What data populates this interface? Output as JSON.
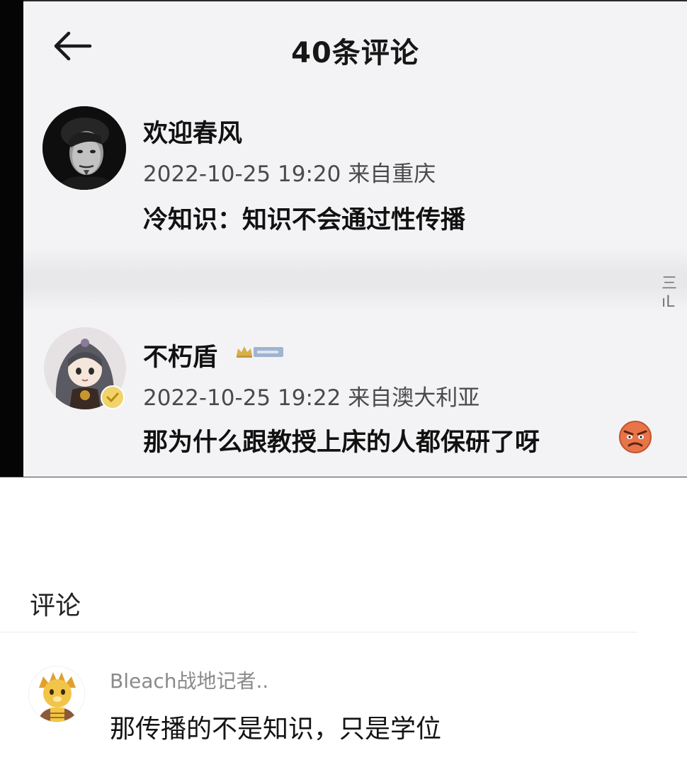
{
  "screenshot": {
    "title": "40条评论",
    "side_glyph": "三ıL",
    "comments": [
      {
        "username": "欢迎春风",
        "meta": "2022-10-25 19:20 来自重庆",
        "text": "冷知识：知识不会通过性传播",
        "avatar_icon": "man-portrait-avatar"
      },
      {
        "username": "不朽盾",
        "meta": "2022-10-25 19:22 来自澳大利亚",
        "text": "那为什么跟教授上床的人都保研了呀",
        "avatar_icon": "anime-character-avatar",
        "badge_icon": "member-badge-icon",
        "emoji": "angry-face-emoji"
      }
    ]
  },
  "comments_section": {
    "title": "评论",
    "items": [
      {
        "username": "Bleach战地记者..",
        "text": "那传播的不是知识，只是学位",
        "avatar_icon": "lion-cartoon-avatar"
      }
    ]
  },
  "colors": {
    "screenshot_bg": "#f3f3f5",
    "left_bar": "#050505",
    "meta_text": "#4a4a4a",
    "commenter_name": "#8a8a8a"
  }
}
